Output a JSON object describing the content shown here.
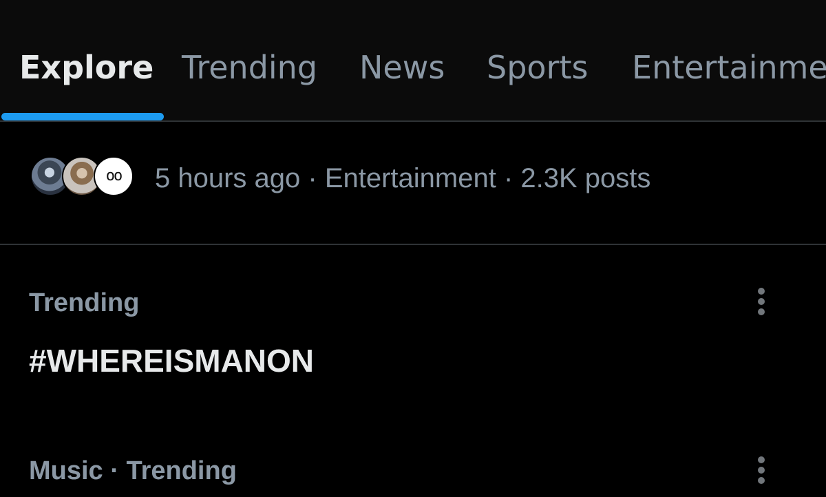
{
  "tabs": [
    {
      "label": "Explore",
      "active": true
    },
    {
      "label": "Trending",
      "active": false
    },
    {
      "label": "News",
      "active": false
    },
    {
      "label": "Sports",
      "active": false
    },
    {
      "label": "Entertainme",
      "active": false
    }
  ],
  "meta_row": {
    "text": "5 hours ago · Entertainment · 2.3K posts",
    "avatars": [
      "avatar-user-1",
      "avatar-user-2",
      "avatar-user-3"
    ]
  },
  "trends": [
    {
      "context": "Trending",
      "title": "#WHEREISMANON"
    },
    {
      "context": "Music · Trending",
      "title": ""
    }
  ],
  "icons": {
    "more": "more-vertical-icon"
  },
  "colors": {
    "accent": "#1d9bf0",
    "background": "#000000",
    "primary_text": "#e7e9ea",
    "secondary_text": "#8b98a5",
    "divider": "#2f3336"
  }
}
